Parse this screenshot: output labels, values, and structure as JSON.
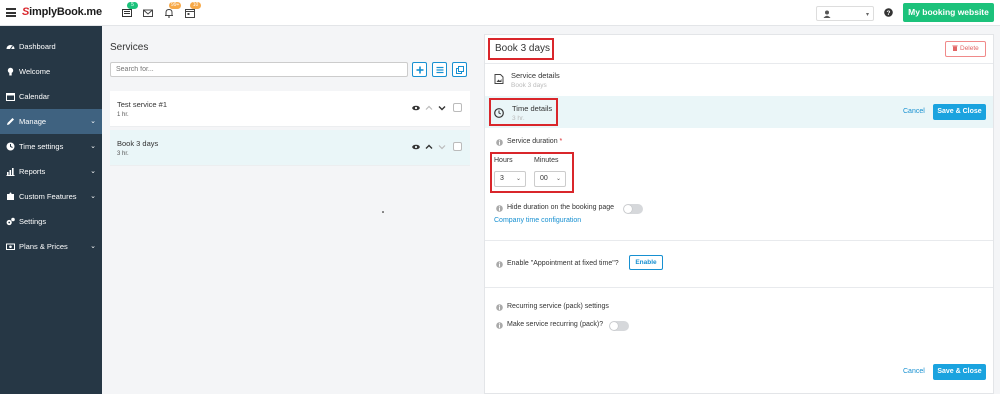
{
  "topbar": {
    "logo_s": "S",
    "logo_rest": "implyBook.me",
    "badges": [
      "5",
      "99+",
      "10"
    ],
    "help_label": "?",
    "booking_button": "My booking website",
    "colors": {
      "accent_green": "#1cc27b",
      "badge_green": "#1cc27b",
      "badge_orange": "#f7a948"
    }
  },
  "sidebar": {
    "items": [
      {
        "label": "Dashboard",
        "icon": "dashboard-icon",
        "active": false,
        "has_chevron": false
      },
      {
        "label": "Welcome",
        "icon": "lightbulb-icon",
        "active": false,
        "has_chevron": false
      },
      {
        "label": "Calendar",
        "icon": "calendar-icon",
        "active": false,
        "has_chevron": false
      },
      {
        "label": "Manage",
        "icon": "pencil-icon",
        "active": true,
        "has_chevron": true
      },
      {
        "label": "Time settings",
        "icon": "clock-icon",
        "active": false,
        "has_chevron": true
      },
      {
        "label": "Reports",
        "icon": "bar-chart-icon",
        "active": false,
        "has_chevron": true
      },
      {
        "label": "Custom Features",
        "icon": "puzzle-icon",
        "active": false,
        "has_chevron": true
      },
      {
        "label": "Settings",
        "icon": "gears-icon",
        "active": false,
        "has_chevron": false
      },
      {
        "label": "Plans & Prices",
        "icon": "price-tag-icon",
        "active": false,
        "has_chevron": true
      }
    ],
    "colors": {
      "background": "#263745",
      "active": "#3f6280"
    }
  },
  "services": {
    "title": "Services",
    "search_placeholder": "Search for...",
    "list": [
      {
        "name": "Test service #1",
        "duration": "1 hr.",
        "selected": false
      },
      {
        "name": "Book 3 days",
        "duration": "3 hr.",
        "selected": true
      }
    ]
  },
  "detail": {
    "title": "Book 3 days",
    "delete_label": "Delete",
    "service_details": {
      "label": "Service details",
      "sub": "Book 3 days"
    },
    "time_details": {
      "label": "Time details",
      "sub": "3 hr."
    },
    "cancel_label": "Cancel",
    "save_label": "Save & Close",
    "duration": {
      "label": "Service duration",
      "required_mark": "*",
      "hours_label": "Hours",
      "minutes_label": "Minutes",
      "hours_value": "3",
      "minutes_value": "00"
    },
    "hide_duration_label": "Hide duration on the booking page",
    "company_time_link": "Company time configuration",
    "fixed_time_label": "Enable \"Appointment at fixed time\"?",
    "enable_label": "Enable",
    "recurring_label": "Recurring service (pack) settings",
    "make_recurring_label": "Make service recurring (pack)?",
    "colors": {
      "primary_blue": "#1aa3df",
      "highlight_red": "#d9262b",
      "danger": "#e26666"
    }
  }
}
